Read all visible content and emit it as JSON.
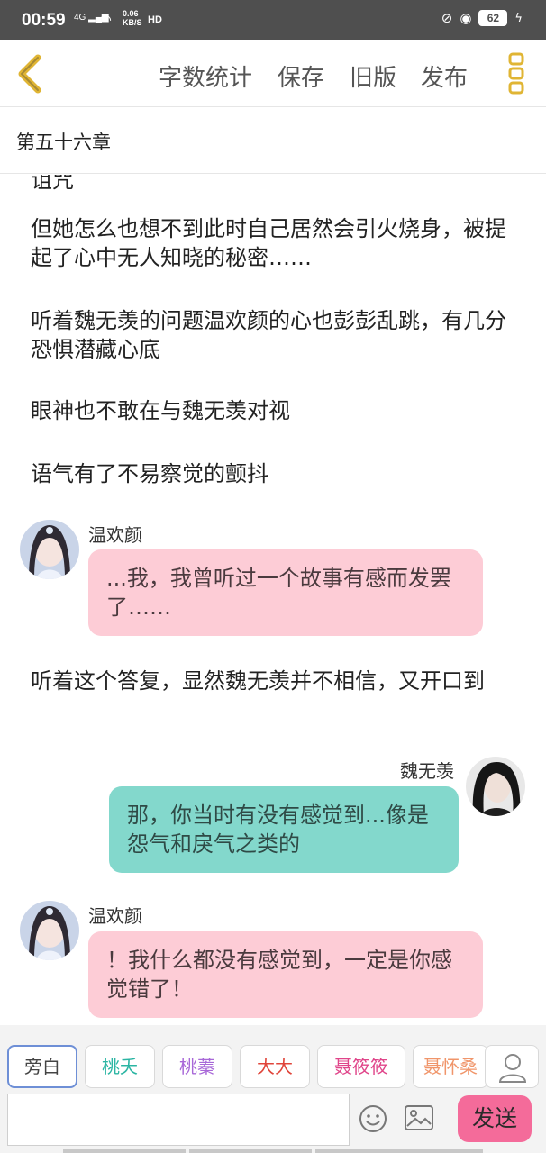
{
  "status_bar": {
    "time": "00:59",
    "signal": "4G",
    "speed_value": "0.06",
    "speed_unit": "KB/S",
    "hd": "HD",
    "battery": "62"
  },
  "header": {
    "menu": [
      "字数统计",
      "保存",
      "旧版",
      "发布"
    ]
  },
  "chapter": {
    "title": "第五十六章"
  },
  "content": {
    "clipped_top_text": "诅咒",
    "paragraphs": [
      "但她怎么也想不到此时自己居然会引火烧身，被提起了心中无人知晓的秘密……",
      "听着魏无羡的问题温欢颜的心也彭彭乱跳，有几分恐惧潜藏心底",
      "眼神也不敢在与魏无羡对视",
      "语气有了不易察觉的颤抖"
    ],
    "dialogue": [
      {
        "speaker": "温欢颜",
        "text": "...我，我曾听过一个故事有感而发罢了……"
      },
      {
        "narration": "听着这个答复，显然魏无羡并不相信，又开口到"
      },
      {
        "speaker": "魏无羡",
        "text": "那，你当时有没有感觉到...像是怨气和戾气之类的"
      },
      {
        "speaker": "温欢颜",
        "text": "！我什么都没有感觉到，一定是你感觉错了！"
      }
    ]
  },
  "roles": [
    {
      "label": "旁白",
      "color": "#444444"
    },
    {
      "label": "桃夭",
      "color": "#2bb5a3"
    },
    {
      "label": "桃蓁",
      "color": "#a868d8"
    },
    {
      "label": "大大",
      "color": "#e0453a"
    },
    {
      "label": "聂筱筱",
      "color": "#e0458a"
    },
    {
      "label": "聂怀桑",
      "color": "#f0956a"
    }
  ],
  "composer": {
    "placeholder": "",
    "send_label": "发送"
  },
  "colors": {
    "accent_yellow": "#e0b534",
    "pink_bubble": "#fdccd6",
    "teal_bubble": "#83d8cc",
    "send_button": "#f46b9a"
  }
}
